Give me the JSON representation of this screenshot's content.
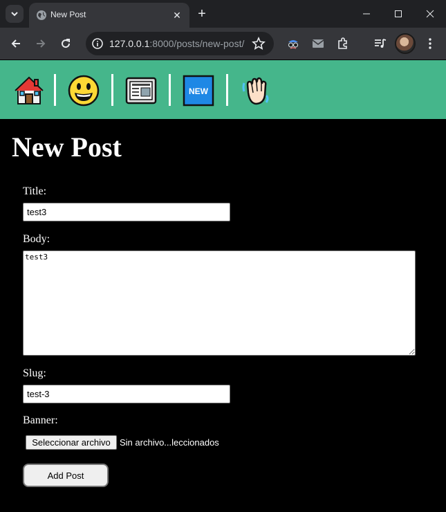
{
  "browser": {
    "tab_title": "New Post",
    "url_host": "127.0.0.1",
    "url_rest": ":8000/posts/new-post/",
    "accent_tab": "#35363a",
    "accent_frame": "#202124"
  },
  "navbar": {
    "color": "#45b68b",
    "items": [
      {
        "icon": "house-icon",
        "label": "home"
      },
      {
        "icon": "smiley-face-icon",
        "label": "about"
      },
      {
        "icon": "newspaper-icon",
        "label": "posts"
      },
      {
        "icon": "new-badge-icon",
        "label": "new post",
        "badge_text": "NEW"
      },
      {
        "icon": "waving-hand-icon",
        "label": "logout"
      }
    ]
  },
  "page": {
    "title": "New Post"
  },
  "form": {
    "title_label": "Title:",
    "title_value": "test3",
    "body_label": "Body:",
    "body_value": "test3",
    "slug_label": "Slug:",
    "slug_value": "test-3",
    "banner_label": "Banner:",
    "file_button": "Seleccionar archivo",
    "file_status": "Sin archivo...leccionados",
    "submit_label": "Add Post"
  }
}
